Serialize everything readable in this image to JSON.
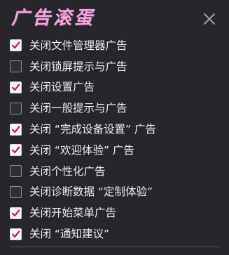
{
  "title": "广告滚蛋",
  "colors": {
    "title": "#f0a8de",
    "background": "#26262b",
    "checkmark": "#c2185b",
    "text": "#ededf0"
  },
  "close_icon": "close-icon",
  "options": [
    {
      "label": "关闭文件管理器广告",
      "checked": true
    },
    {
      "label": "关闭锁屏提示与广告",
      "checked": false
    },
    {
      "label": "关闭设置广告",
      "checked": true
    },
    {
      "label": "关闭一般提示与广告",
      "checked": false
    },
    {
      "label": "关闭 “完成设备设置” 广告",
      "checked": true
    },
    {
      "label": "关闭 “欢迎体验” 广告",
      "checked": true
    },
    {
      "label": "关闭个性化广告",
      "checked": false
    },
    {
      "label": "关闭诊断数据 “定制体验”",
      "checked": false
    },
    {
      "label": "关闭开始菜单广告",
      "checked": true
    },
    {
      "label": "关闭 “通知建议”",
      "checked": true
    }
  ]
}
